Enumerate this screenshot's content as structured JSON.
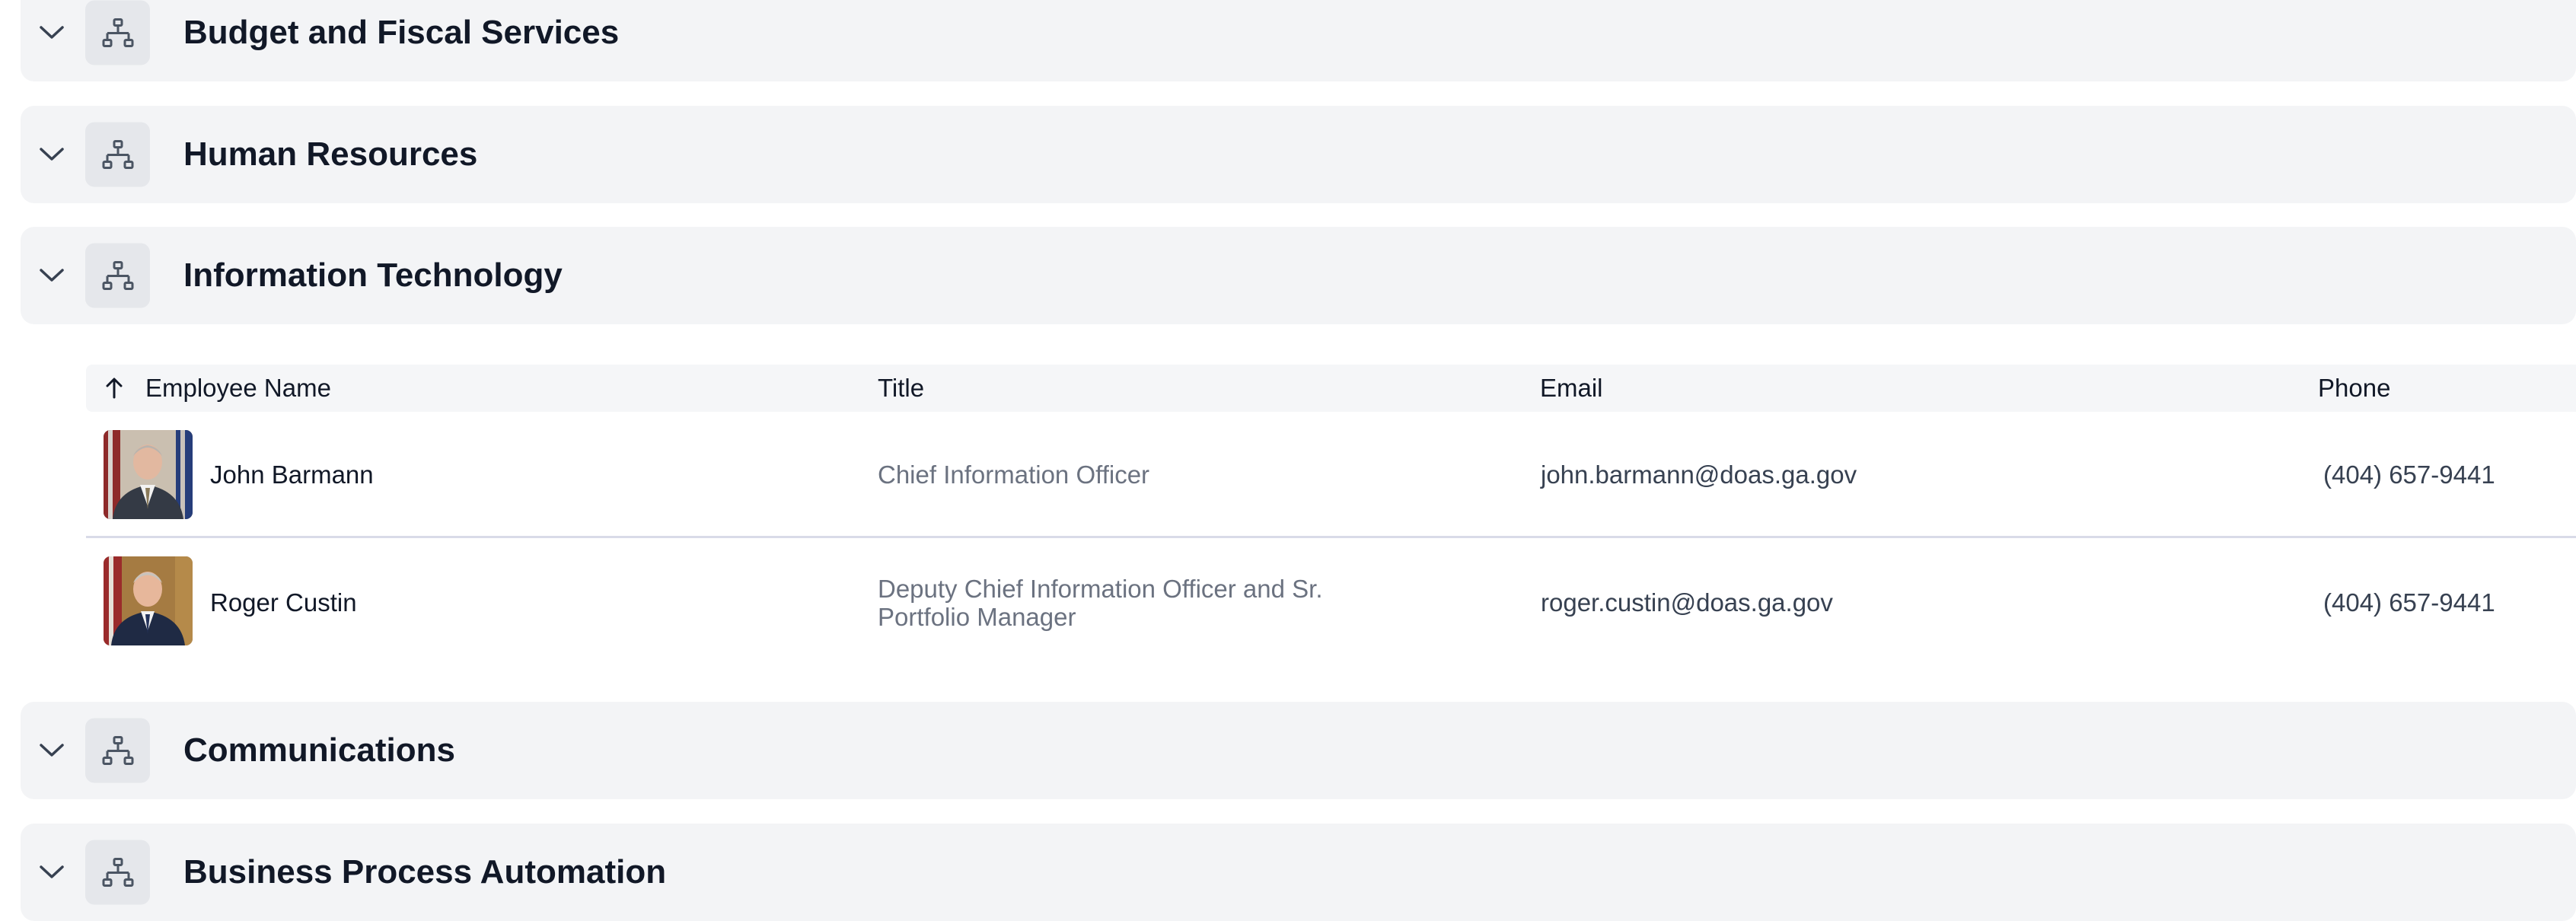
{
  "sections_top": [
    {
      "title": "Budget and Fiscal Services"
    },
    {
      "title": "Human Resources"
    },
    {
      "title": "Information Technology"
    }
  ],
  "sections_bottom": [
    {
      "title": "Communications"
    },
    {
      "title": "Business Process Automation"
    }
  ],
  "table": {
    "columns": {
      "name": "Employee Name",
      "title": "Title",
      "email": "Email",
      "phone": "Phone"
    },
    "rows": [
      {
        "name": "John Barmann",
        "title": "Chief Information Officer",
        "email": "john.barmann@doas.ga.gov",
        "phone": "(404) 657-9441"
      },
      {
        "name": "Roger Custin",
        "title": "Deputy Chief Information Officer and Sr. Portfolio Manager",
        "email": "roger.custin@doas.ga.gov",
        "phone": "(404) 657-9441"
      }
    ]
  },
  "icons": {
    "expand": "chevron-down-icon",
    "section": "org-chart-icon",
    "sort": "arrow-up-icon"
  },
  "colors": {
    "section_bg": "#f3f4f6",
    "icon_box_bg": "#e5e7eb",
    "icon_stroke": "#4b5563"
  }
}
